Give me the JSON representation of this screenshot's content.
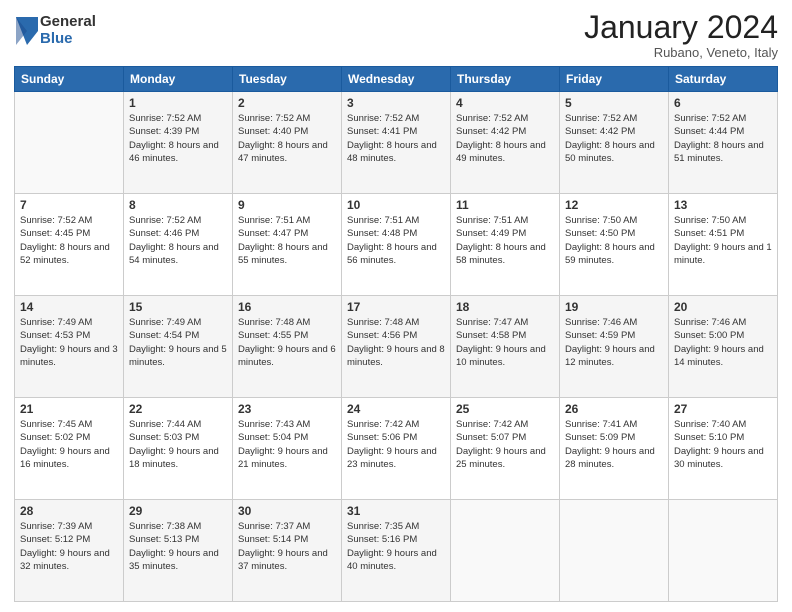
{
  "logo": {
    "general": "General",
    "blue": "Blue"
  },
  "header": {
    "month": "January 2024",
    "location": "Rubano, Veneto, Italy"
  },
  "days": [
    "Sunday",
    "Monday",
    "Tuesday",
    "Wednesday",
    "Thursday",
    "Friday",
    "Saturday"
  ],
  "weeks": [
    [
      {
        "day": "",
        "sunrise": "",
        "sunset": "",
        "daylight": ""
      },
      {
        "day": "1",
        "sunrise": "Sunrise: 7:52 AM",
        "sunset": "Sunset: 4:39 PM",
        "daylight": "Daylight: 8 hours and 46 minutes."
      },
      {
        "day": "2",
        "sunrise": "Sunrise: 7:52 AM",
        "sunset": "Sunset: 4:40 PM",
        "daylight": "Daylight: 8 hours and 47 minutes."
      },
      {
        "day": "3",
        "sunrise": "Sunrise: 7:52 AM",
        "sunset": "Sunset: 4:41 PM",
        "daylight": "Daylight: 8 hours and 48 minutes."
      },
      {
        "day": "4",
        "sunrise": "Sunrise: 7:52 AM",
        "sunset": "Sunset: 4:42 PM",
        "daylight": "Daylight: 8 hours and 49 minutes."
      },
      {
        "day": "5",
        "sunrise": "Sunrise: 7:52 AM",
        "sunset": "Sunset: 4:42 PM",
        "daylight": "Daylight: 8 hours and 50 minutes."
      },
      {
        "day": "6",
        "sunrise": "Sunrise: 7:52 AM",
        "sunset": "Sunset: 4:44 PM",
        "daylight": "Daylight: 8 hours and 51 minutes."
      }
    ],
    [
      {
        "day": "7",
        "sunrise": "Sunrise: 7:52 AM",
        "sunset": "Sunset: 4:45 PM",
        "daylight": "Daylight: 8 hours and 52 minutes."
      },
      {
        "day": "8",
        "sunrise": "Sunrise: 7:52 AM",
        "sunset": "Sunset: 4:46 PM",
        "daylight": "Daylight: 8 hours and 54 minutes."
      },
      {
        "day": "9",
        "sunrise": "Sunrise: 7:51 AM",
        "sunset": "Sunset: 4:47 PM",
        "daylight": "Daylight: 8 hours and 55 minutes."
      },
      {
        "day": "10",
        "sunrise": "Sunrise: 7:51 AM",
        "sunset": "Sunset: 4:48 PM",
        "daylight": "Daylight: 8 hours and 56 minutes."
      },
      {
        "day": "11",
        "sunrise": "Sunrise: 7:51 AM",
        "sunset": "Sunset: 4:49 PM",
        "daylight": "Daylight: 8 hours and 58 minutes."
      },
      {
        "day": "12",
        "sunrise": "Sunrise: 7:50 AM",
        "sunset": "Sunset: 4:50 PM",
        "daylight": "Daylight: 8 hours and 59 minutes."
      },
      {
        "day": "13",
        "sunrise": "Sunrise: 7:50 AM",
        "sunset": "Sunset: 4:51 PM",
        "daylight": "Daylight: 9 hours and 1 minute."
      }
    ],
    [
      {
        "day": "14",
        "sunrise": "Sunrise: 7:49 AM",
        "sunset": "Sunset: 4:53 PM",
        "daylight": "Daylight: 9 hours and 3 minutes."
      },
      {
        "day": "15",
        "sunrise": "Sunrise: 7:49 AM",
        "sunset": "Sunset: 4:54 PM",
        "daylight": "Daylight: 9 hours and 5 minutes."
      },
      {
        "day": "16",
        "sunrise": "Sunrise: 7:48 AM",
        "sunset": "Sunset: 4:55 PM",
        "daylight": "Daylight: 9 hours and 6 minutes."
      },
      {
        "day": "17",
        "sunrise": "Sunrise: 7:48 AM",
        "sunset": "Sunset: 4:56 PM",
        "daylight": "Daylight: 9 hours and 8 minutes."
      },
      {
        "day": "18",
        "sunrise": "Sunrise: 7:47 AM",
        "sunset": "Sunset: 4:58 PM",
        "daylight": "Daylight: 9 hours and 10 minutes."
      },
      {
        "day": "19",
        "sunrise": "Sunrise: 7:46 AM",
        "sunset": "Sunset: 4:59 PM",
        "daylight": "Daylight: 9 hours and 12 minutes."
      },
      {
        "day": "20",
        "sunrise": "Sunrise: 7:46 AM",
        "sunset": "Sunset: 5:00 PM",
        "daylight": "Daylight: 9 hours and 14 minutes."
      }
    ],
    [
      {
        "day": "21",
        "sunrise": "Sunrise: 7:45 AM",
        "sunset": "Sunset: 5:02 PM",
        "daylight": "Daylight: 9 hours and 16 minutes."
      },
      {
        "day": "22",
        "sunrise": "Sunrise: 7:44 AM",
        "sunset": "Sunset: 5:03 PM",
        "daylight": "Daylight: 9 hours and 18 minutes."
      },
      {
        "day": "23",
        "sunrise": "Sunrise: 7:43 AM",
        "sunset": "Sunset: 5:04 PM",
        "daylight": "Daylight: 9 hours and 21 minutes."
      },
      {
        "day": "24",
        "sunrise": "Sunrise: 7:42 AM",
        "sunset": "Sunset: 5:06 PM",
        "daylight": "Daylight: 9 hours and 23 minutes."
      },
      {
        "day": "25",
        "sunrise": "Sunrise: 7:42 AM",
        "sunset": "Sunset: 5:07 PM",
        "daylight": "Daylight: 9 hours and 25 minutes."
      },
      {
        "day": "26",
        "sunrise": "Sunrise: 7:41 AM",
        "sunset": "Sunset: 5:09 PM",
        "daylight": "Daylight: 9 hours and 28 minutes."
      },
      {
        "day": "27",
        "sunrise": "Sunrise: 7:40 AM",
        "sunset": "Sunset: 5:10 PM",
        "daylight": "Daylight: 9 hours and 30 minutes."
      }
    ],
    [
      {
        "day": "28",
        "sunrise": "Sunrise: 7:39 AM",
        "sunset": "Sunset: 5:12 PM",
        "daylight": "Daylight: 9 hours and 32 minutes."
      },
      {
        "day": "29",
        "sunrise": "Sunrise: 7:38 AM",
        "sunset": "Sunset: 5:13 PM",
        "daylight": "Daylight: 9 hours and 35 minutes."
      },
      {
        "day": "30",
        "sunrise": "Sunrise: 7:37 AM",
        "sunset": "Sunset: 5:14 PM",
        "daylight": "Daylight: 9 hours and 37 minutes."
      },
      {
        "day": "31",
        "sunrise": "Sunrise: 7:35 AM",
        "sunset": "Sunset: 5:16 PM",
        "daylight": "Daylight: 9 hours and 40 minutes."
      },
      {
        "day": "",
        "sunrise": "",
        "sunset": "",
        "daylight": ""
      },
      {
        "day": "",
        "sunrise": "",
        "sunset": "",
        "daylight": ""
      },
      {
        "day": "",
        "sunrise": "",
        "sunset": "",
        "daylight": ""
      }
    ]
  ]
}
